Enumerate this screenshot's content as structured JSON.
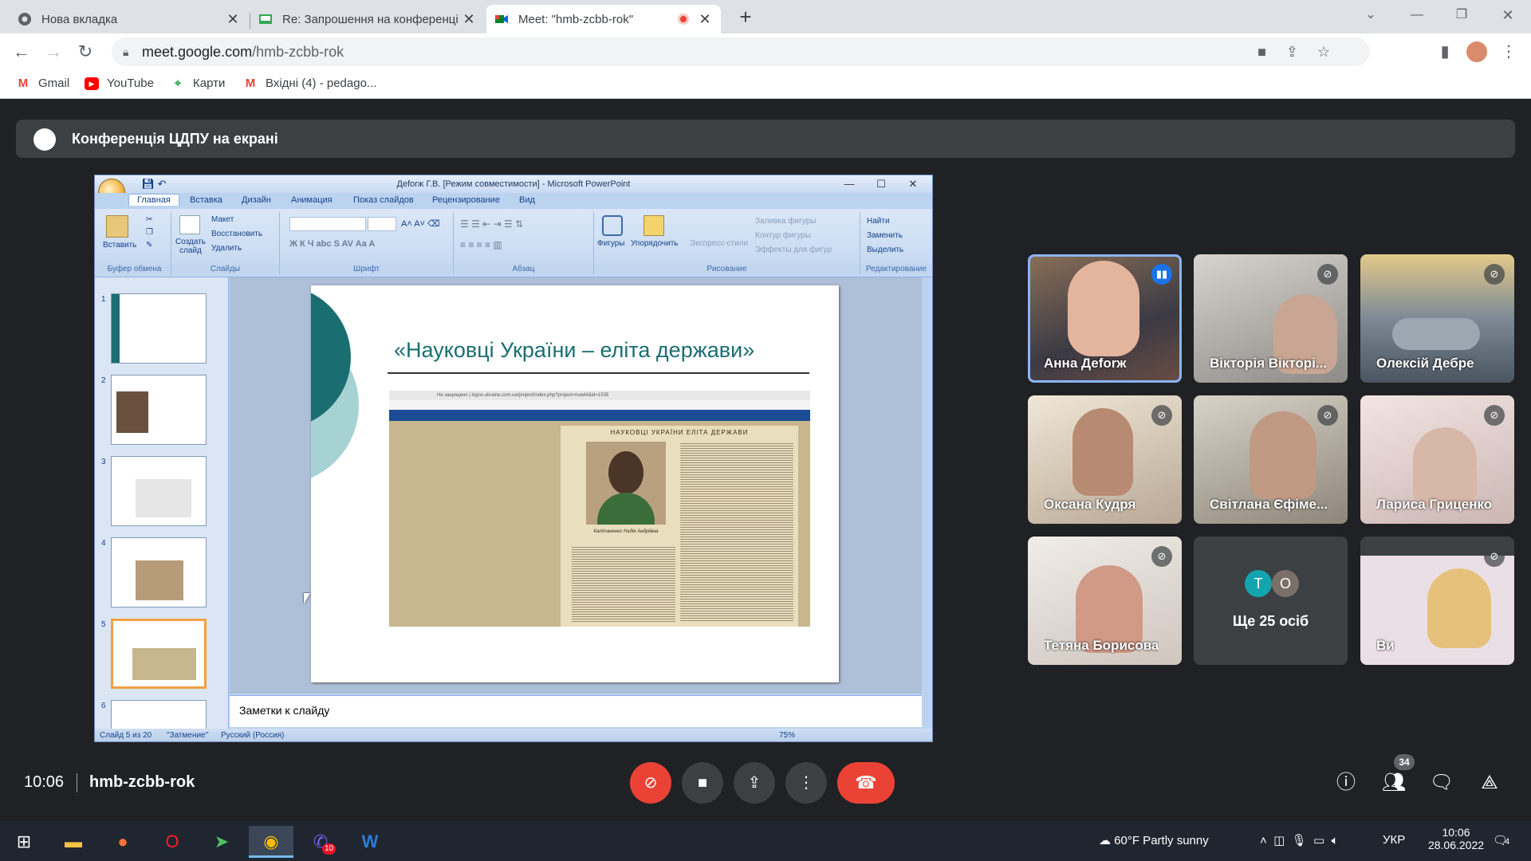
{
  "browser": {
    "tabs": [
      {
        "title": "Нова вкладка",
        "icon": "chrome-icon"
      },
      {
        "title": "Re: Запрошення на конференці",
        "icon": "mail-icon"
      },
      {
        "title": "Meet: \"hmb-zcbb-rok\"",
        "icon": "meet-icon",
        "recording": true
      }
    ],
    "url_host": "meet.google.com",
    "url_path": "/hmb-zcbb-rok",
    "bookmarks": [
      "Gmail",
      "YouTube",
      "Карти",
      "Вхідні (4) - pedago..."
    ]
  },
  "meet": {
    "presentation_banner": "Конференція ЦДПУ на екрані",
    "time": "10:06",
    "meeting_code": "hmb-zcbb-rok",
    "participants_count": "34",
    "more_people_label": "Ще 25 осіб",
    "more_people_initials": [
      "T",
      "O"
    ],
    "participants": [
      {
        "name": "Анна Деforж",
        "speaking": true,
        "muted": false
      },
      {
        "name": "Вікторія Вікторі...",
        "speaking": false,
        "muted": true
      },
      {
        "name": "Олексій Дебре",
        "speaking": false,
        "muted": true
      },
      {
        "name": "Оксана Кудря",
        "speaking": false,
        "muted": true
      },
      {
        "name": "Світлана Єфіме...",
        "speaking": false,
        "muted": true
      },
      {
        "name": "Лариса Гриценко",
        "speaking": false,
        "muted": true
      },
      {
        "name": "Тетяна Борисова",
        "speaking": false,
        "muted": true
      },
      {
        "name": "Ви",
        "speaking": false,
        "muted": true
      }
    ],
    "colors": {
      "bg": "#202124",
      "red": "#ea4335",
      "tile": "#3c4043",
      "speaking": "#1a73e8"
    }
  },
  "ppt": {
    "window_title": "Деforж Г.В. [Режим совместимости] - Microsoft PowerPoint",
    "ribbon_tabs": [
      "Главная",
      "Вставка",
      "Дизайн",
      "Анимация",
      "Показ слайдов",
      "Рецензирование",
      "Вид"
    ],
    "groups": {
      "clipboard": "Буфер обмена",
      "slides": "Слайды",
      "font": "Шрифт",
      "paragraph": "Абзац",
      "drawing": "Рисование",
      "editing": "Редактирование"
    },
    "items": {
      "paste": "Вставить",
      "create_slide": "Создать слайд",
      "layout": "Макет",
      "reset": "Восстановить",
      "delete": "Удалить",
      "shapes": "Фигуры",
      "arrange": "Упорядочить",
      "quick_styles": "Экспресс-стили",
      "shape_fill": "Заливка фигуры",
      "shape_outline": "Контур фигуры",
      "shape_effects": "Эффекты для фигур",
      "find": "Найти",
      "replace": "Заменить",
      "select": "Выделить"
    },
    "slide_numbers": [
      "1",
      "2",
      "3",
      "4",
      "5",
      "6"
    ],
    "slide_title": "«Науковці України – еліта держави»",
    "web_address": "Не защищено | logos-ukraine.com.ua/project/index.php?project=nued4&id=1535",
    "web_banner": "НАУКОВЦІ УКРАЇНИ ЕЛІТА ДЕРЖАВИ",
    "person_caption": "Капітаненко Надія Андріївна",
    "notes_placeholder": "Заметки к слайду",
    "status_slide": "Слайд 5 из 20",
    "status_theme": "\"Затмение\"",
    "status_lang": "Русский (Россия)",
    "zoom": "75%"
  },
  "taskbar": {
    "weather": "60°F  Partly sunny",
    "lang": "УКР",
    "time": "10:06",
    "date": "28.06.2022",
    "notifications": "4",
    "viber_badge": "10"
  }
}
